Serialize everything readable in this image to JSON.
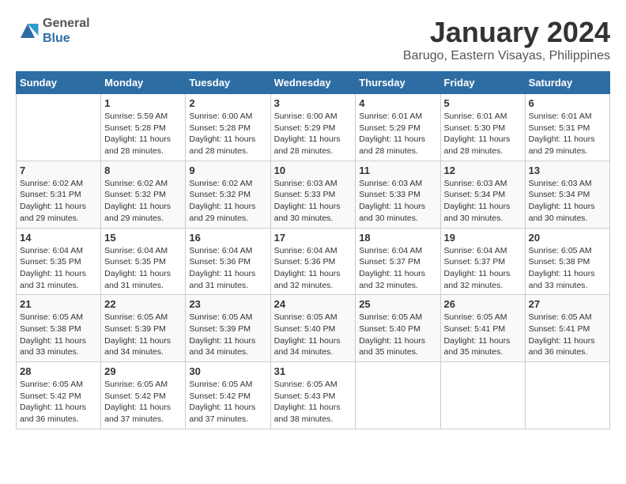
{
  "logo": {
    "general": "General",
    "blue": "Blue"
  },
  "title": "January 2024",
  "subtitle": "Barugo, Eastern Visayas, Philippines",
  "days_of_week": [
    "Sunday",
    "Monday",
    "Tuesday",
    "Wednesday",
    "Thursday",
    "Friday",
    "Saturday"
  ],
  "weeks": [
    [
      {
        "day": "",
        "info": ""
      },
      {
        "day": "1",
        "info": "Sunrise: 5:59 AM\nSunset: 5:28 PM\nDaylight: 11 hours\nand 28 minutes."
      },
      {
        "day": "2",
        "info": "Sunrise: 6:00 AM\nSunset: 5:28 PM\nDaylight: 11 hours\nand 28 minutes."
      },
      {
        "day": "3",
        "info": "Sunrise: 6:00 AM\nSunset: 5:29 PM\nDaylight: 11 hours\nand 28 minutes."
      },
      {
        "day": "4",
        "info": "Sunrise: 6:01 AM\nSunset: 5:29 PM\nDaylight: 11 hours\nand 28 minutes."
      },
      {
        "day": "5",
        "info": "Sunrise: 6:01 AM\nSunset: 5:30 PM\nDaylight: 11 hours\nand 28 minutes."
      },
      {
        "day": "6",
        "info": "Sunrise: 6:01 AM\nSunset: 5:31 PM\nDaylight: 11 hours\nand 29 minutes."
      }
    ],
    [
      {
        "day": "7",
        "info": "Sunrise: 6:02 AM\nSunset: 5:31 PM\nDaylight: 11 hours\nand 29 minutes."
      },
      {
        "day": "8",
        "info": "Sunrise: 6:02 AM\nSunset: 5:32 PM\nDaylight: 11 hours\nand 29 minutes."
      },
      {
        "day": "9",
        "info": "Sunrise: 6:02 AM\nSunset: 5:32 PM\nDaylight: 11 hours\nand 29 minutes."
      },
      {
        "day": "10",
        "info": "Sunrise: 6:03 AM\nSunset: 5:33 PM\nDaylight: 11 hours\nand 30 minutes."
      },
      {
        "day": "11",
        "info": "Sunrise: 6:03 AM\nSunset: 5:33 PM\nDaylight: 11 hours\nand 30 minutes."
      },
      {
        "day": "12",
        "info": "Sunrise: 6:03 AM\nSunset: 5:34 PM\nDaylight: 11 hours\nand 30 minutes."
      },
      {
        "day": "13",
        "info": "Sunrise: 6:03 AM\nSunset: 5:34 PM\nDaylight: 11 hours\nand 30 minutes."
      }
    ],
    [
      {
        "day": "14",
        "info": "Sunrise: 6:04 AM\nSunset: 5:35 PM\nDaylight: 11 hours\nand 31 minutes."
      },
      {
        "day": "15",
        "info": "Sunrise: 6:04 AM\nSunset: 5:35 PM\nDaylight: 11 hours\nand 31 minutes."
      },
      {
        "day": "16",
        "info": "Sunrise: 6:04 AM\nSunset: 5:36 PM\nDaylight: 11 hours\nand 31 minutes."
      },
      {
        "day": "17",
        "info": "Sunrise: 6:04 AM\nSunset: 5:36 PM\nDaylight: 11 hours\nand 32 minutes."
      },
      {
        "day": "18",
        "info": "Sunrise: 6:04 AM\nSunset: 5:37 PM\nDaylight: 11 hours\nand 32 minutes."
      },
      {
        "day": "19",
        "info": "Sunrise: 6:04 AM\nSunset: 5:37 PM\nDaylight: 11 hours\nand 32 minutes."
      },
      {
        "day": "20",
        "info": "Sunrise: 6:05 AM\nSunset: 5:38 PM\nDaylight: 11 hours\nand 33 minutes."
      }
    ],
    [
      {
        "day": "21",
        "info": "Sunrise: 6:05 AM\nSunset: 5:38 PM\nDaylight: 11 hours\nand 33 minutes."
      },
      {
        "day": "22",
        "info": "Sunrise: 6:05 AM\nSunset: 5:39 PM\nDaylight: 11 hours\nand 34 minutes."
      },
      {
        "day": "23",
        "info": "Sunrise: 6:05 AM\nSunset: 5:39 PM\nDaylight: 11 hours\nand 34 minutes."
      },
      {
        "day": "24",
        "info": "Sunrise: 6:05 AM\nSunset: 5:40 PM\nDaylight: 11 hours\nand 34 minutes."
      },
      {
        "day": "25",
        "info": "Sunrise: 6:05 AM\nSunset: 5:40 PM\nDaylight: 11 hours\nand 35 minutes."
      },
      {
        "day": "26",
        "info": "Sunrise: 6:05 AM\nSunset: 5:41 PM\nDaylight: 11 hours\nand 35 minutes."
      },
      {
        "day": "27",
        "info": "Sunrise: 6:05 AM\nSunset: 5:41 PM\nDaylight: 11 hours\nand 36 minutes."
      }
    ],
    [
      {
        "day": "28",
        "info": "Sunrise: 6:05 AM\nSunset: 5:42 PM\nDaylight: 11 hours\nand 36 minutes."
      },
      {
        "day": "29",
        "info": "Sunrise: 6:05 AM\nSunset: 5:42 PM\nDaylight: 11 hours\nand 37 minutes."
      },
      {
        "day": "30",
        "info": "Sunrise: 6:05 AM\nSunset: 5:42 PM\nDaylight: 11 hours\nand 37 minutes."
      },
      {
        "day": "31",
        "info": "Sunrise: 6:05 AM\nSunset: 5:43 PM\nDaylight: 11 hours\nand 38 minutes."
      },
      {
        "day": "",
        "info": ""
      },
      {
        "day": "",
        "info": ""
      },
      {
        "day": "",
        "info": ""
      }
    ]
  ]
}
